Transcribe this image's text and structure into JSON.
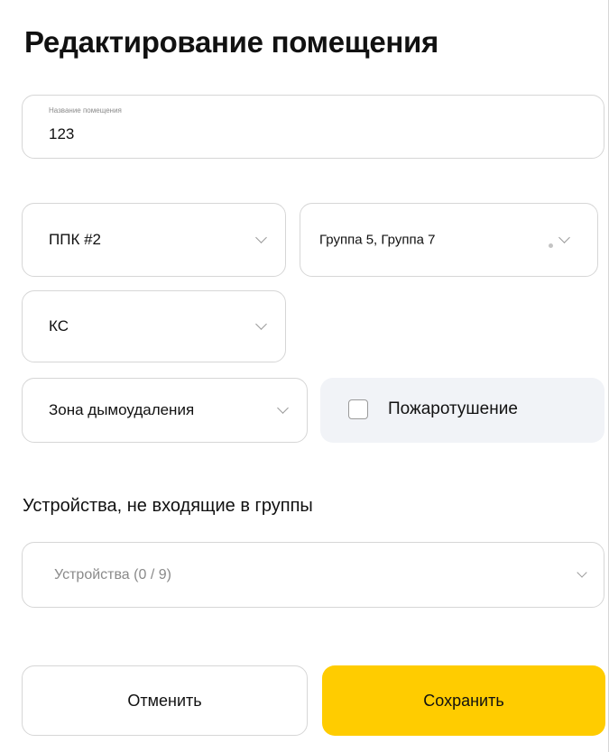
{
  "title": "Редактирование помещения",
  "name_field": {
    "label": "Название помещения",
    "value": "123"
  },
  "ppk_select": {
    "value": "ППК #2"
  },
  "groups_select": {
    "value": "Группа 5, Группа 7"
  },
  "ks_select": {
    "value": "КС"
  },
  "zone_select": {
    "value": "Зона дымоудаления"
  },
  "fire_extinguishing": {
    "label": "Пожаротушение",
    "checked": false
  },
  "devices_section": {
    "label": "Устройства, не входящие в группы",
    "placeholder": "Устройства (0 / 9)"
  },
  "buttons": {
    "cancel": "Отменить",
    "save": "Сохранить"
  },
  "colors": {
    "accent": "#ffcc00",
    "border": "#d6d6d6",
    "panel": "#f1f3f7"
  },
  "icons": {
    "dropdown": "chevron-down-icon",
    "checkbox": "checkbox-icon"
  }
}
